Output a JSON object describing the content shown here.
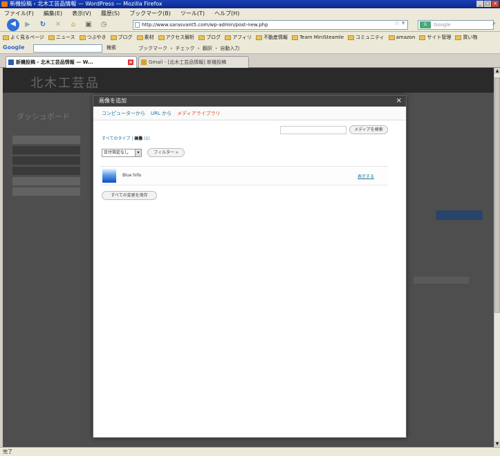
{
  "window": {
    "title": "新機投稿 ‹ 北木工芸品情報 — WordPress — Mozilla Firefox"
  },
  "menu": [
    "ファイル(F)",
    "編集(E)",
    "表示(V)",
    "履歴(S)",
    "ブックマーク(B)",
    "ツール(T)",
    "ヘルプ(H)"
  ],
  "navigation": {
    "url": "http://www.sarasvant5.com/wp-admin/post-new.php",
    "search_engine": "Google"
  },
  "bookmarks": [
    "よく見るページ",
    "ニュース",
    "つぶやき",
    "ブログ",
    "素材",
    "アクセス解析",
    "ブログ",
    "アフィリ",
    "不動産情報",
    "Team MiniSteamle",
    "コミュニティ",
    "amazon",
    "サイト管理",
    "買い物"
  ],
  "google_toolbar": {
    "logo": "Google",
    "search_label": "検索",
    "tools": "ブックマーク ・ チェック ・ 翻訳 ・ 自動入力"
  },
  "tabs": [
    {
      "label": "新機投稿 ‹ 北木工芸品情報 — W...",
      "active": true
    },
    {
      "label": "Gmail - [北木工芸品情報] 新機投稿",
      "active": false
    }
  ],
  "wp_background": {
    "site_title": "北木工芸品",
    "dashboard_title": "ダッシュボード"
  },
  "modal": {
    "title": "画像を追加",
    "close_glyph": "×",
    "tabs": [
      {
        "label": "コンピューターから",
        "current": false
      },
      {
        "label": "URL から",
        "current": false
      },
      {
        "label": "メディアライブラリ",
        "current": true
      }
    ],
    "search_button": "メディアを検索",
    "filter_all": "すべてのタイプ",
    "filter_separator": " | ",
    "filter_current": "画像",
    "filter_count": "(1)",
    "date_select": "日付指定なし",
    "filter_button": "フィルター »",
    "item": {
      "title": "Blue hills",
      "show_link": "表示する"
    },
    "save_all_button": "すべての変更を保存"
  },
  "status": "完了"
}
